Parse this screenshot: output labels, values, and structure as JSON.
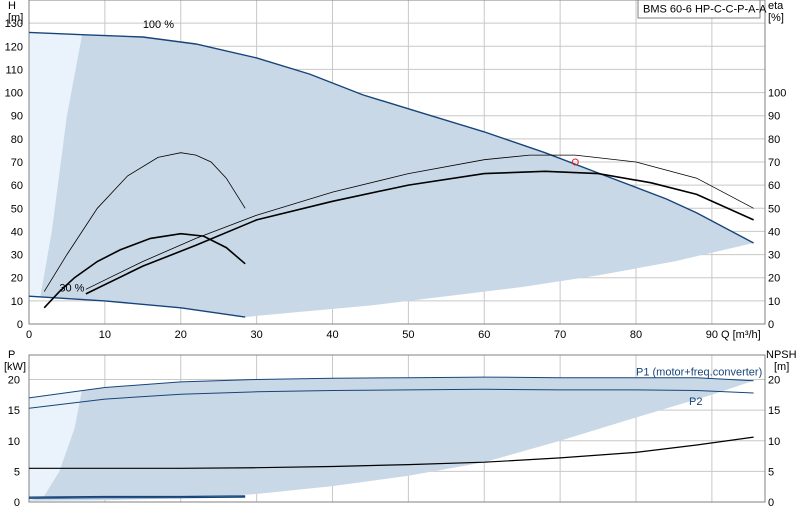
{
  "title_box": "BMS 60-6 HP-C-C-P-A-A",
  "colors": {
    "envelope": "#c9d8e6",
    "envelope_edge": "#17457a",
    "light_region": "#eaf3fb",
    "curve": "#000000",
    "grid": "#c8c8c8",
    "marker": "#e0202a"
  },
  "chart_data": [
    {
      "type": "line",
      "panel": "head_efficiency",
      "y_left_label": [
        "H",
        "[m]"
      ],
      "y_right_label": [
        "eta",
        "[%]"
      ],
      "x_label": "Q [m³/h]",
      "xlim": [
        0,
        97
      ],
      "ylim": [
        0,
        140
      ],
      "x_ticks": [
        0,
        10,
        20,
        30,
        40,
        50,
        60,
        70,
        80,
        90
      ],
      "y_left_ticks": [
        0,
        10,
        20,
        30,
        40,
        50,
        60,
        70,
        80,
        90,
        100,
        110,
        120,
        130
      ],
      "y_right_ticks": [
        0,
        10,
        20,
        30,
        40,
        50,
        60,
        70,
        80,
        90,
        100
      ],
      "annotations": [
        {
          "text": "100 %",
          "x": 15,
          "y": 128
        },
        {
          "text": "30 %",
          "x": 4,
          "y": 14
        }
      ],
      "envelope": {
        "upper": [
          [
            0,
            126
          ],
          [
            7,
            125
          ],
          [
            15,
            124
          ],
          [
            22,
            121
          ],
          [
            30,
            115
          ],
          [
            37,
            108
          ],
          [
            44,
            99
          ],
          [
            52,
            91
          ],
          [
            60,
            83
          ],
          [
            68,
            74
          ],
          [
            76,
            64
          ],
          [
            84,
            54
          ],
          [
            88,
            48
          ],
          [
            95.5,
            35
          ]
        ],
        "lower": [
          [
            95.5,
            35
          ],
          [
            85,
            27
          ],
          [
            75,
            21
          ],
          [
            65,
            16
          ],
          [
            55,
            12
          ],
          [
            45,
            8
          ],
          [
            35,
            5
          ],
          [
            30,
            3.5
          ],
          [
            28.5,
            3
          ]
        ],
        "min_speed": [
          [
            28.5,
            3
          ],
          [
            20,
            7
          ],
          [
            10,
            10
          ],
          [
            0,
            12
          ]
        ]
      },
      "light_region": [
        [
          0,
          126
        ],
        [
          7,
          125
        ],
        [
          5,
          90
        ],
        [
          3,
          40
        ],
        [
          1.5,
          12
        ],
        [
          0,
          12
        ]
      ],
      "series": [
        {
          "role": "envelope_upper",
          "points": [
            [
              0,
              126
            ],
            [
              7,
              125
            ],
            [
              15,
              124
            ],
            [
              22,
              121
            ],
            [
              30,
              115
            ],
            [
              37,
              108
            ],
            [
              44,
              99
            ],
            [
              52,
              91
            ],
            [
              60,
              83
            ],
            [
              68,
              74
            ],
            [
              76,
              64
            ],
            [
              84,
              54
            ],
            [
              88,
              48
            ],
            [
              95.5,
              35
            ]
          ]
        },
        {
          "role": "envelope_lower",
          "points": [
            [
              0,
              12
            ],
            [
              10,
              10
            ],
            [
              20,
              7
            ],
            [
              28.5,
              3
            ]
          ]
        },
        {
          "role": "eta_100",
          "points": [
            [
              7.5,
              15
            ],
            [
              15,
              27
            ],
            [
              22,
              37
            ],
            [
              30,
              47
            ],
            [
              40,
              57
            ],
            [
              50,
              65
            ],
            [
              60,
              71
            ],
            [
              66,
              73
            ],
            [
              72,
              73
            ],
            [
              80,
              70
            ],
            [
              88,
              63
            ],
            [
              95.5,
              50
            ]
          ]
        },
        {
          "role": "head_100",
          "points": [
            [
              7.5,
              13
            ],
            [
              15,
              25
            ],
            [
              22,
              34
            ],
            [
              30,
              45
            ],
            [
              40,
              53
            ],
            [
              50,
              60
            ],
            [
              60,
              65
            ],
            [
              68,
              66
            ],
            [
              75,
              65
            ],
            [
              82,
              61
            ],
            [
              88,
              56
            ],
            [
              95.5,
              45
            ]
          ]
        },
        {
          "role": "eta_30",
          "points": [
            [
              2,
              14
            ],
            [
              5,
              30
            ],
            [
              9,
              50
            ],
            [
              13,
              64
            ],
            [
              17,
              72
            ],
            [
              20,
              74
            ],
            [
              22,
              73
            ],
            [
              24,
              70
            ],
            [
              26,
              63
            ],
            [
              28.5,
              50
            ]
          ]
        },
        {
          "role": "head_30",
          "points": [
            [
              2,
              7
            ],
            [
              4,
              14
            ],
            [
              6,
              20
            ],
            [
              9,
              27
            ],
            [
              12,
              32
            ],
            [
              16,
              37
            ],
            [
              20,
              39
            ],
            [
              23,
              38
            ],
            [
              26,
              33
            ],
            [
              28.5,
              26
            ]
          ]
        }
      ],
      "marker": {
        "x": 72,
        "y": 70
      }
    },
    {
      "type": "line",
      "panel": "power_npsh",
      "y_left_label": [
        "P",
        "[kW]"
      ],
      "y_right_label": [
        "NPSH",
        "[m]"
      ],
      "xlim": [
        0,
        97
      ],
      "ylim": [
        0,
        24
      ],
      "y_left_ticks": [
        0,
        5,
        10,
        15,
        20
      ],
      "y_right_ticks": [
        0,
        5,
        10,
        15,
        20
      ],
      "labels": [
        {
          "text": "P1 (motor+freq.converter)",
          "x": 87,
          "y": 20.8
        },
        {
          "text": "P2",
          "x": 95.5,
          "y": 16.5
        }
      ],
      "envelope_poly": [
        [
          0,
          17
        ],
        [
          10,
          18.7
        ],
        [
          20,
          19.6
        ],
        [
          30,
          20
        ],
        [
          50,
          20.3
        ],
        [
          70,
          20.3
        ],
        [
          88,
          20.3
        ],
        [
          95.5,
          19.8
        ],
        [
          90,
          17.5
        ],
        [
          80,
          13.8
        ],
        [
          70,
          10
        ],
        [
          60,
          6.5
        ],
        [
          50,
          4.3
        ],
        [
          40,
          2.6
        ],
        [
          30,
          1.3
        ],
        [
          20,
          0.6
        ],
        [
          10,
          0.3
        ],
        [
          0,
          0.2
        ]
      ],
      "light_region": [
        [
          0,
          17
        ],
        [
          7,
          18.3
        ],
        [
          6,
          12
        ],
        [
          4,
          5
        ],
        [
          2,
          1
        ],
        [
          0,
          0.2
        ]
      ],
      "series": [
        {
          "name": "P1 (motor+freq.converter)",
          "points": [
            [
              0,
              17
            ],
            [
              10,
              18.7
            ],
            [
              20,
              19.6
            ],
            [
              30,
              20
            ],
            [
              40,
              20.2
            ],
            [
              50,
              20.3
            ],
            [
              60,
              20.4
            ],
            [
              70,
              20.3
            ],
            [
              80,
              20.3
            ],
            [
              88,
              20.3
            ],
            [
              95.5,
              19.8
            ]
          ]
        },
        {
          "name": "P2",
          "points": [
            [
              0,
              15.3
            ],
            [
              10,
              16.8
            ],
            [
              20,
              17.6
            ],
            [
              30,
              18
            ],
            [
              40,
              18.2
            ],
            [
              50,
              18.3
            ],
            [
              60,
              18.4
            ],
            [
              70,
              18.3
            ],
            [
              80,
              18.3
            ],
            [
              88,
              18.2
            ],
            [
              95.5,
              17.8
            ]
          ]
        },
        {
          "role": "npsh",
          "points": [
            [
              0,
              5.5
            ],
            [
              10,
              5.5
            ],
            [
              20,
              5.5
            ],
            [
              30,
              5.6
            ],
            [
              40,
              5.8
            ],
            [
              50,
              6.1
            ],
            [
              60,
              6.5
            ],
            [
              70,
              7.2
            ],
            [
              80,
              8.1
            ],
            [
              88,
              9.3
            ],
            [
              95.5,
              10.6
            ]
          ]
        },
        {
          "role": "p_30_upper",
          "points": [
            [
              0,
              0.8
            ],
            [
              10,
              0.9
            ],
            [
              20,
              0.9
            ],
            [
              28.5,
              1
            ]
          ]
        },
        {
          "role": "p_30_lower",
          "points": [
            [
              0,
              0.6
            ],
            [
              10,
              0.7
            ],
            [
              20,
              0.7
            ],
            [
              28.5,
              0.8
            ]
          ]
        }
      ]
    }
  ]
}
